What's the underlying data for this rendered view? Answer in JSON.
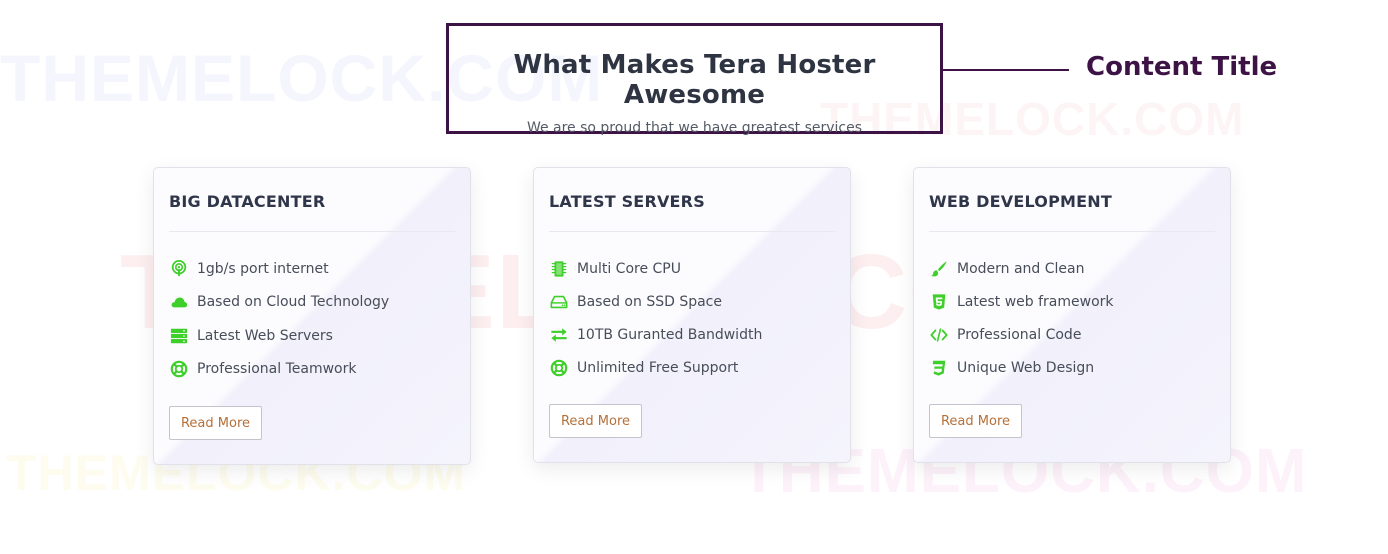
{
  "watermarks": [
    "THEMELOCK.COM",
    "THEMELOCK.COM",
    "THEMELOCK.COM",
    "THEMELOCK.COM",
    "THEMELOCK.COM"
  ],
  "header": {
    "title": "What Makes Tera Hoster Awesome",
    "subtitle": "We are so proud that we have greatest services"
  },
  "annotation": {
    "label": "Content Title"
  },
  "colors": {
    "accent_green": "#3fcf2a",
    "annotation_purple": "#3d1245",
    "button_text": "#b5703a",
    "title_text": "#2e3441"
  },
  "cards": [
    {
      "title": "BIG DATACENTER",
      "features": [
        {
          "icon": "podcast-icon",
          "text": "1gb/s port internet"
        },
        {
          "icon": "cloud-icon",
          "text": "Based on Cloud Technology"
        },
        {
          "icon": "server-icon",
          "text": "Latest Web Servers"
        },
        {
          "icon": "life-ring-icon",
          "text": "Professional Teamwork"
        }
      ],
      "button": "Read More"
    },
    {
      "title": "LATEST SERVERS",
      "features": [
        {
          "icon": "microchip-icon",
          "text": "Multi Core CPU"
        },
        {
          "icon": "hdd-icon",
          "text": "Based on SSD Space"
        },
        {
          "icon": "exchange-icon",
          "text": "10TB Guranted Bandwidth"
        },
        {
          "icon": "life-ring-icon",
          "text": "Unlimited Free Support"
        }
      ],
      "button": "Read More"
    },
    {
      "title": "WEB DEVELOPMENT",
      "features": [
        {
          "icon": "paint-brush-icon",
          "text": "Modern and Clean"
        },
        {
          "icon": "html5-icon",
          "text": "Latest web framework"
        },
        {
          "icon": "code-icon",
          "text": "Professional Code"
        },
        {
          "icon": "css3-icon",
          "text": "Unique Web Design"
        }
      ],
      "button": "Read More"
    }
  ]
}
